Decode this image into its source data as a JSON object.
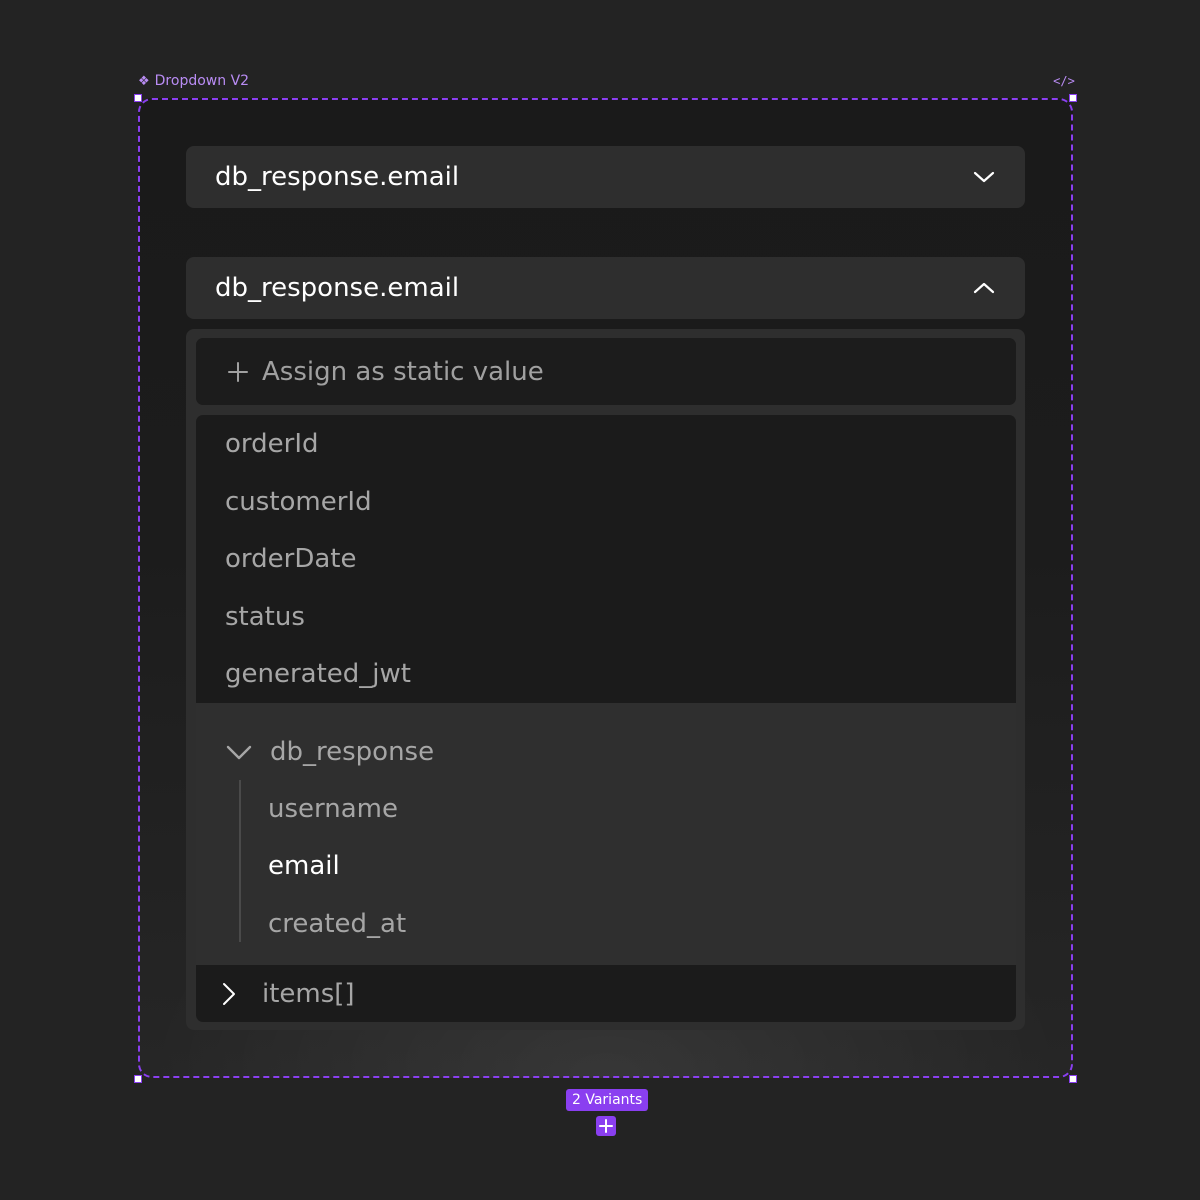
{
  "frame": {
    "name": "Dropdown V2",
    "component_icon": "component-icon",
    "code_icon": "code-icon",
    "accent_color": "#8a3ff0"
  },
  "dropdown_closed": {
    "value": "db_response.email",
    "icon": "chevron-down-icon"
  },
  "dropdown_open": {
    "value": "db_response.email",
    "icon": "chevron-up-icon",
    "static_button": {
      "label": "Assign as static value",
      "icon": "plus-icon"
    },
    "items": [
      {
        "label": "orderId"
      },
      {
        "label": "customerId"
      },
      {
        "label": "orderDate"
      },
      {
        "label": "status"
      },
      {
        "label": "generated_jwt"
      }
    ],
    "group": {
      "label": "db_response",
      "expanded": true,
      "children": [
        {
          "label": "username",
          "selected": false
        },
        {
          "label": "email",
          "selected": true
        },
        {
          "label": "created_at",
          "selected": false
        }
      ]
    },
    "collapsed_group": {
      "label": "items[]",
      "expanded": false
    }
  },
  "variants": {
    "label": "2 Variants"
  }
}
